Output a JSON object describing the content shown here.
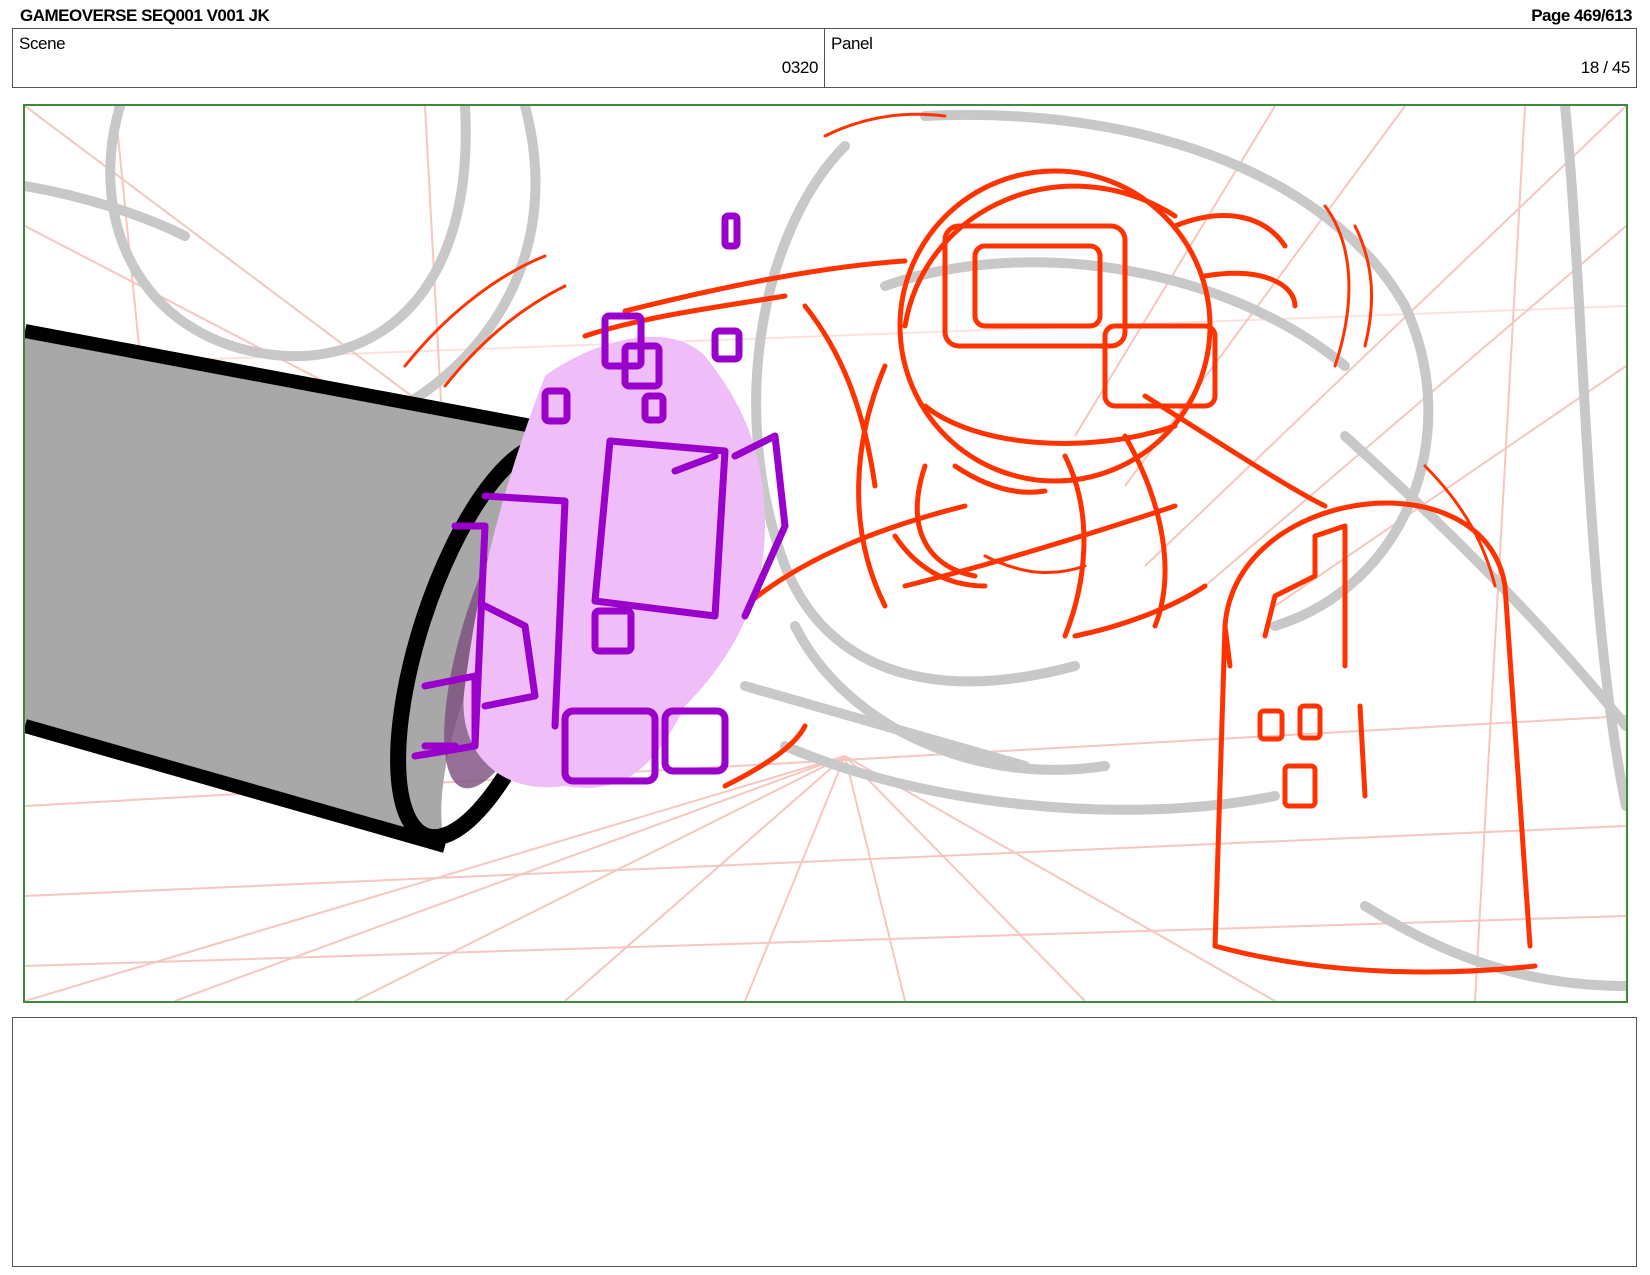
{
  "header": {
    "title": "GAMEOVERSE SEQ001 V001 JK",
    "page": "Page 469/613"
  },
  "info": {
    "scene_label": "Scene",
    "scene_value": "0320",
    "panel_label": "Panel",
    "panel_value": "18 / 45"
  },
  "colors": {
    "frame_border": "#3c8a3c",
    "sketch_red": "#ff3300",
    "sketch_purple": "#9900cc",
    "purple_fill": "#efbdf7",
    "grid_pink": "#f6c6c0",
    "rough_gray": "#c8c8c8",
    "cylinder_gray": "#a8a8a8"
  },
  "notes": {
    "text": ""
  }
}
